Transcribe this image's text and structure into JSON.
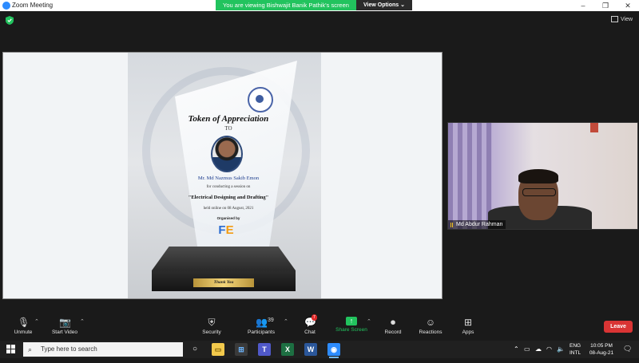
{
  "window": {
    "title": "Zoom Meeting",
    "controls": [
      "–",
      "❐",
      "✕"
    ]
  },
  "share_banner": {
    "text": "You are viewing Bishwajit Banik Pathik's screen",
    "options_label": "View Options ⌄"
  },
  "view_button": {
    "label": "View"
  },
  "trophy": {
    "title": "Token of Appreciation",
    "to": "TO",
    "recipient": "Mr. Md Nazmus Sakib Emon",
    "line1": "for conducting a session on",
    "session": "\"Electrical Designing and Drafting\"",
    "held": "held online on 08 August, 2021",
    "organized_by": "Organised by",
    "logo_text": "FE",
    "plaque": "Thank You"
  },
  "participant": {
    "name": "Md Abdur Rahman"
  },
  "toolbar": {
    "unmute": "Unmute",
    "start_video": "Start Video",
    "security": "Security",
    "participants": "Participants",
    "participants_count": "39",
    "chat": "Chat",
    "chat_badge": "7",
    "share_screen": "Share Screen",
    "record": "Record",
    "reactions": "Reactions",
    "apps": "Apps",
    "leave": "Leave"
  },
  "taskbar": {
    "search_placeholder": "Type here to search",
    "lang_top": "ENG",
    "lang_bottom": "INTL",
    "time": "10:05 PM",
    "date": "08-Aug-21",
    "apps": [
      "File Explorer",
      "Microsoft Store",
      "Teams",
      "Excel",
      "Word",
      "Zoom"
    ]
  },
  "colors": {
    "share_green": "#22c35e",
    "leave_red": "#d93434",
    "zoom_blue": "#2d8cff"
  }
}
